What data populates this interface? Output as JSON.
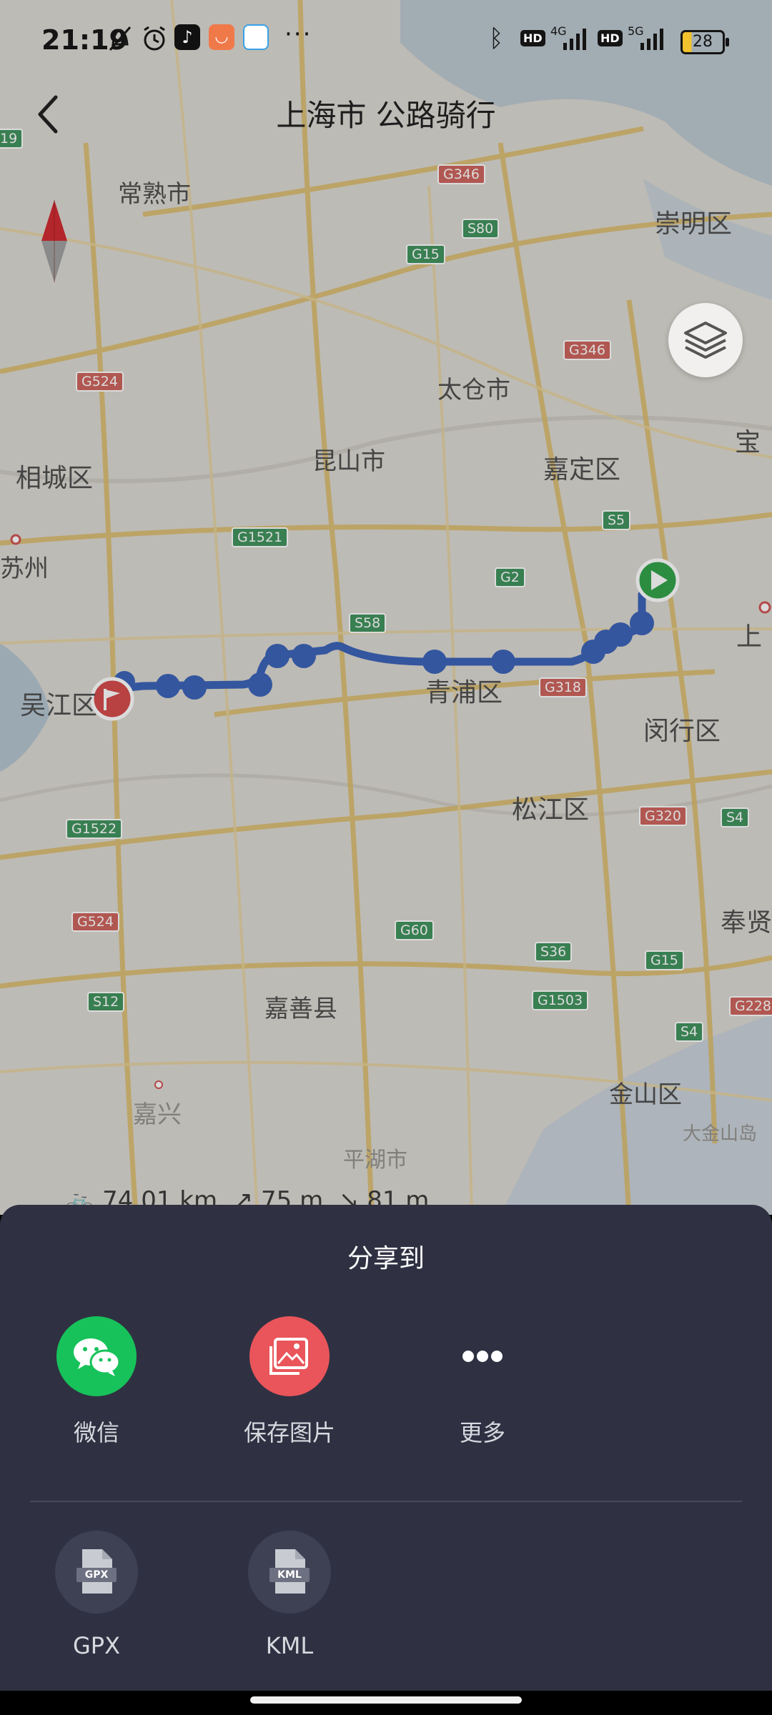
{
  "status_bar": {
    "time": "21:19",
    "icons": [
      "mute-icon",
      "alarm-icon",
      "tiktok-icon",
      "shopping-icon",
      "chat-app-icon",
      "more-dots-icon",
      "bluetooth-icon",
      "hd-icon",
      "signal-4g-icon",
      "hd-icon",
      "signal-5g-icon"
    ],
    "more": "···",
    "hd": "HD",
    "net1": "4G",
    "net2": "5G",
    "battery": "28"
  },
  "header": {
    "title": "上海市 公路骑行"
  },
  "map": {
    "places": [
      "常熟市",
      "崇明区",
      "太仓市",
      "昆山市",
      "嘉定区",
      "宝",
      "相城区",
      "苏州",
      "上",
      "吴江区",
      "青浦区",
      "闵行区",
      "松江区",
      "奉贤",
      "嘉善县",
      "嘉兴",
      "金山区",
      "平湖市",
      "大金山岛"
    ],
    "shields": [
      "19",
      "G346",
      "S80",
      "G15",
      "G346",
      "G524",
      "G1521",
      "S5",
      "G2",
      "S58",
      "G318",
      "G320",
      "S4",
      "G1522",
      "G524",
      "G60",
      "S36",
      "G15",
      "G1503",
      "S12",
      "S4",
      "G228"
    ]
  },
  "route_stats": {
    "distance": "74.01 km",
    "ascent": "75 m",
    "descent": "81 m"
  },
  "share_sheet": {
    "title": "分享到",
    "apps": [
      {
        "label": "微信",
        "icon": "wechat-icon",
        "color": "#17c25a"
      },
      {
        "label": "保存图片",
        "icon": "image-icon",
        "color": "#e9555a"
      },
      {
        "label": "更多",
        "icon": "more-icon"
      }
    ],
    "files": [
      {
        "label": "GPX",
        "badge": "GPX",
        "icon": "gpx-file-icon"
      },
      {
        "label": "KML",
        "badge": "KML",
        "icon": "kml-file-icon"
      }
    ]
  },
  "colors": {
    "route": "#2a55b3",
    "start": "#1f9b3a",
    "end": "#d23a3a",
    "sheet": "#2f3142"
  }
}
